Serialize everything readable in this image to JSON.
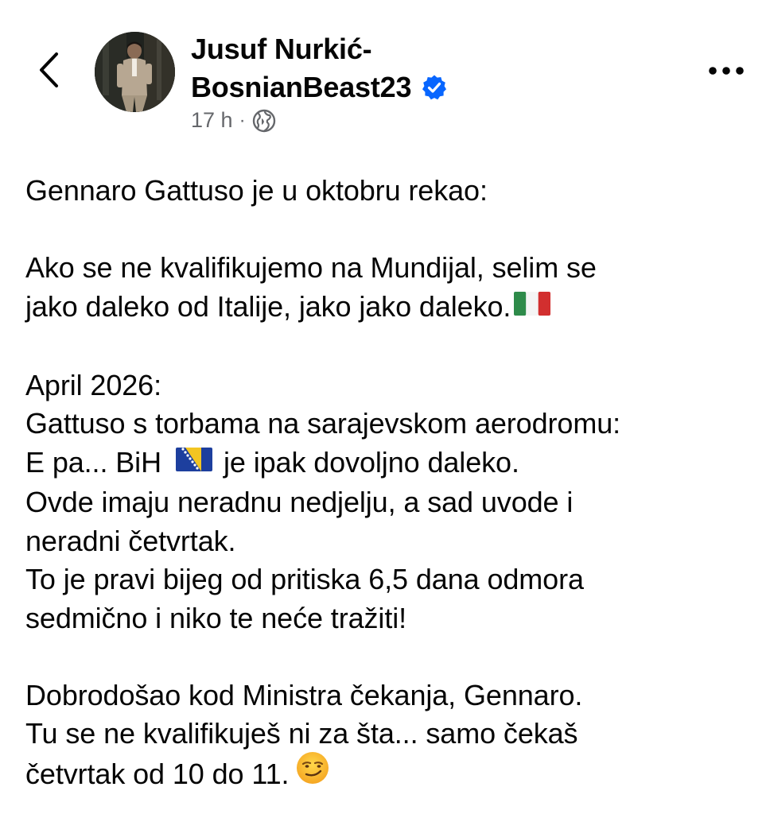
{
  "header": {
    "back_icon": "chevron-left-icon",
    "author_name_line1": "Jusuf Nurkić-",
    "author_name_line2": "BosnianBeast23",
    "verified_icon": "verified-badge-icon",
    "timestamp": "17 h",
    "separator": "·",
    "audience_icon": "globe-icon",
    "more_icon": "more-dots-icon",
    "verified_color": "#0866ff"
  },
  "post": {
    "lines": [
      "Gennaro Gattuso je u oktobru rekao:",
      "",
      "Ako se ne kvalifikujemo na Mundijal, selim se",
      "jako daleko od Italije, jako jako daleko.",
      "",
      "April 2026:",
      "Gattuso s torbama na sarajevskom aerodromu:",
      "E pa... BiH",
      "je ipak dovoljno daleko.",
      "Ovde imaju neradnu nedjelju, a sad uvode i",
      "neradni četvrtak.",
      "To je pravi bijeg od pritiska 6,5 dana odmora",
      "sedmično i niko te neće tražiti!",
      "",
      "Dobrodošao kod Ministra čekanja, Gennaro.",
      "Tu se ne kvalifikuješ ni za šta... samo čekaš",
      "četvrtak od 10 do 11."
    ],
    "emoji": {
      "italy_flag": "flag-italy-icon",
      "bosnia_flag": "flag-bosnia-icon",
      "smirk": "smirking-face-icon"
    }
  }
}
